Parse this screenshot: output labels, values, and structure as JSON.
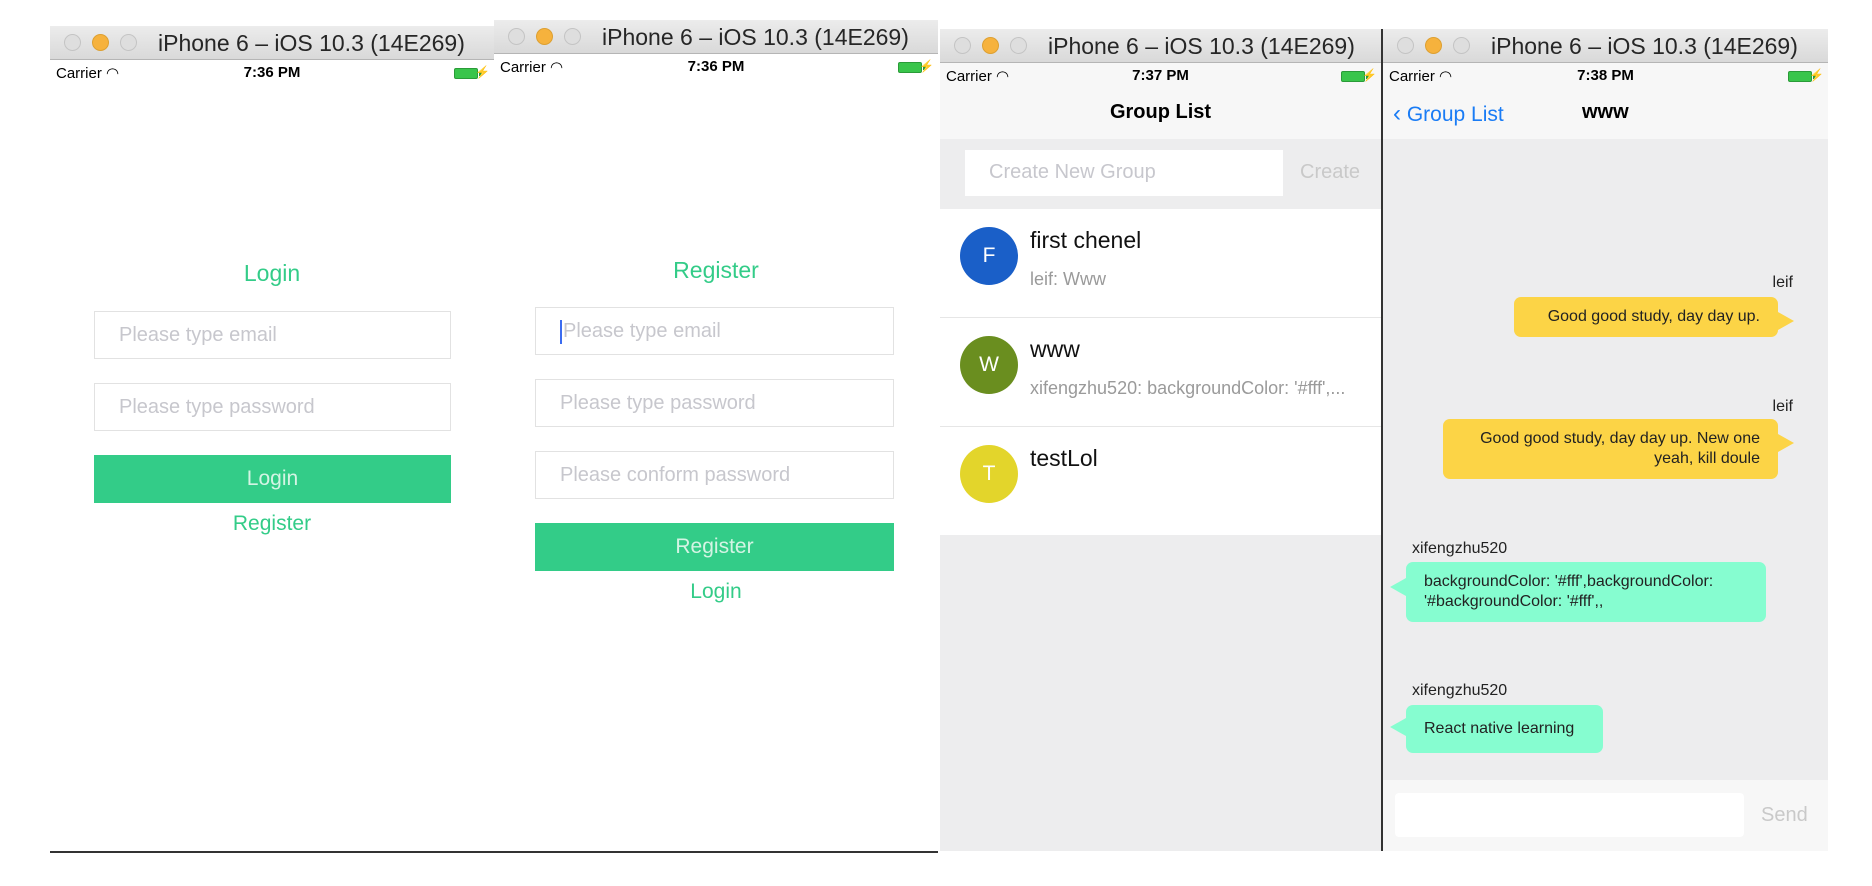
{
  "windows": [
    {
      "title": "iPhone 6 – iOS 10.3 (14E269)",
      "carrier": "Carrier",
      "time": "7:36 PM"
    },
    {
      "title": "iPhone 6 – iOS 10.3 (14E269)",
      "carrier": "Carrier",
      "time": "7:36 PM"
    },
    {
      "title": "iPhone 6 – iOS 10.3 (14E269)",
      "carrier": "Carrier",
      "time": "7:37 PM"
    },
    {
      "title": "iPhone 6 – iOS 10.3 (14E269)",
      "carrier": "Carrier",
      "time": "7:38 PM"
    }
  ],
  "login": {
    "heading": "Login",
    "email_placeholder": "Please type email",
    "password_placeholder": "Please type password",
    "login_button": "Login",
    "register_link": "Register"
  },
  "register": {
    "heading": "Register",
    "email_placeholder": "Please type email",
    "password_placeholder": "Please type password",
    "confirm_placeholder": "Please conform password",
    "register_button": "Register",
    "login_link": "Login"
  },
  "group_list": {
    "nav_title": "Group List",
    "new_group_placeholder": "Create New Group",
    "create_button": "Create",
    "groups": [
      {
        "initial": "F",
        "name": "first chenel",
        "last_message": "leif:  Www",
        "color": "#1a5fc8"
      },
      {
        "initial": "W",
        "name": "www",
        "last_message": "xifengzhu520:  backgroundColor: '#fff',...",
        "color": "#6a8e1f"
      },
      {
        "initial": "T",
        "name": "testLol",
        "last_message": "",
        "color": "#e3d52b"
      }
    ]
  },
  "chat": {
    "back_label": "Group List",
    "nav_title": "www",
    "messages": [
      {
        "sender": "leif",
        "text": "Good good study, day day up.",
        "mine": true
      },
      {
        "sender": "leif",
        "text": "Good good study, day day up. New one yeah, kill doule",
        "mine": true
      },
      {
        "sender": "xifengzhu520",
        "text": "backgroundColor: '#fff',backgroundColor: '#backgroundColor: '#fff',,",
        "mine": false
      },
      {
        "sender": "xifengzhu520",
        "text": "React native learning",
        "mine": false
      }
    ],
    "input_value": "",
    "send_button": "Send"
  },
  "colors": {
    "accent": "#33cc88",
    "my_bubble": "#fcd446",
    "their_bubble": "#86fdd0",
    "chat_bg": "#ededee"
  }
}
